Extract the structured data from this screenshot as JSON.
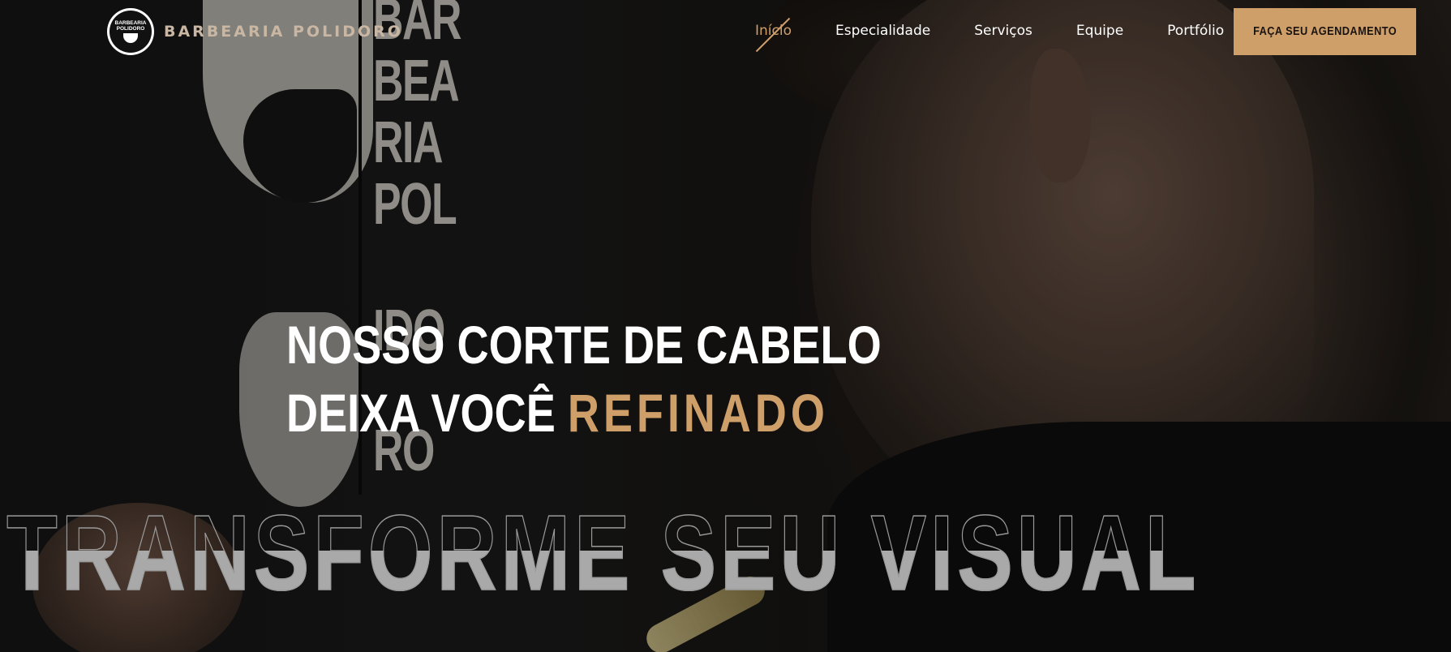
{
  "brand": {
    "badge_line1": "BARBEARIA",
    "badge_line2": "POLIDORO",
    "name": "BARBEARIA POLIDORO"
  },
  "nav": {
    "items": [
      {
        "label": "Início",
        "active": true
      },
      {
        "label": "Especialidade",
        "active": false
      },
      {
        "label": "Serviços",
        "active": false
      },
      {
        "label": "Equipe",
        "active": false
      },
      {
        "label": "Portfólio",
        "active": false
      }
    ]
  },
  "cta": {
    "label": "FAÇA SEU AGENDAMENTO"
  },
  "hero": {
    "line1": "NOSSO CORTE DE CABELO",
    "line2_prefix": "DEIXA VOCÊ",
    "line2_highlight": "REFINADO",
    "backdrop_text": "TRANSFORME SEU VISUAL"
  },
  "wall_mural": {
    "letters": [
      "BAR",
      "BEA",
      "RIA",
      "POL",
      "IDO",
      "RO"
    ]
  },
  "colors": {
    "accent": "#cf9f6a",
    "background": "#0c0c0c",
    "text": "#ffffff"
  }
}
